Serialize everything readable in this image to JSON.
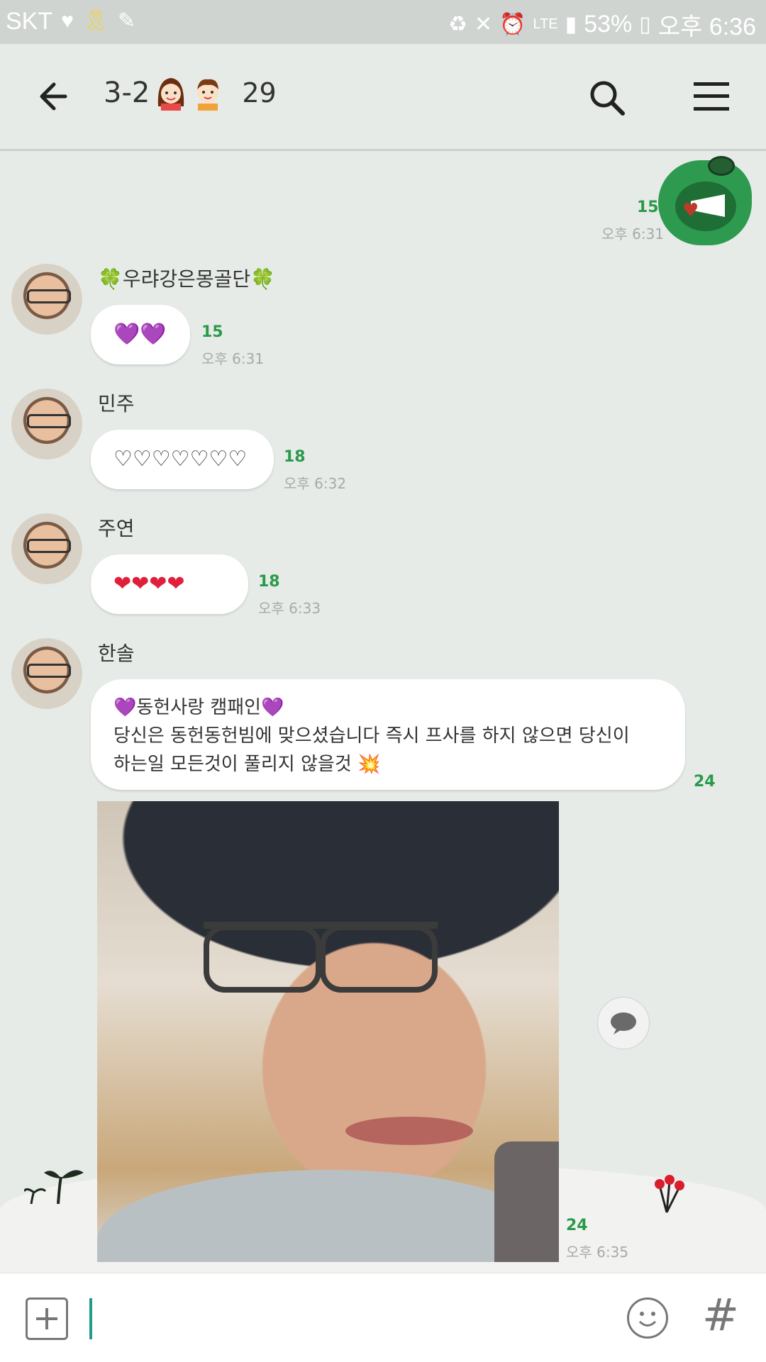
{
  "status_bar": {
    "carrier": "SKT",
    "battery": "53%",
    "time": "오후 6:36",
    "network": "LTE"
  },
  "header": {
    "title": "3-2",
    "member_count": "29"
  },
  "messages": [
    {
      "type": "sticker",
      "from": "me",
      "unread": "15",
      "time": "오후 6:31"
    },
    {
      "sender": "🍀우랴강은몽골단🍀",
      "text": "💜💜",
      "unread": "15",
      "time": "오후 6:31"
    },
    {
      "sender": "민주",
      "text": "♡♡♡♡♡♡♡",
      "unread": "18",
      "time": "오후 6:32"
    },
    {
      "sender": "주연",
      "text": "❤❤❤❤",
      "unread": "18",
      "time": "오후 6:33"
    },
    {
      "sender": "한솔",
      "lines": [
        "💜동헌사랑 캠패인💜",
        "당신은 동헌동헌빔에 맞으셨습니다 즉시 프사를 하지 않으면 당신이",
        "하는일 모든것이 풀리지 않을것 💥"
      ],
      "unread": "24"
    },
    {
      "type": "photo",
      "unread": "24",
      "time": "오후 6:35"
    }
  ],
  "icons": {
    "back": "back-arrow-icon",
    "search": "search-icon",
    "menu": "menu-icon",
    "plus": "plus-icon",
    "emoji": "emoji-icon",
    "hash": "hash-icon",
    "share": "speech-bubble-icon"
  },
  "colors": {
    "background": "#e6ebe7",
    "unread": "#2a9a4a",
    "caret": "#1f9c8a"
  }
}
